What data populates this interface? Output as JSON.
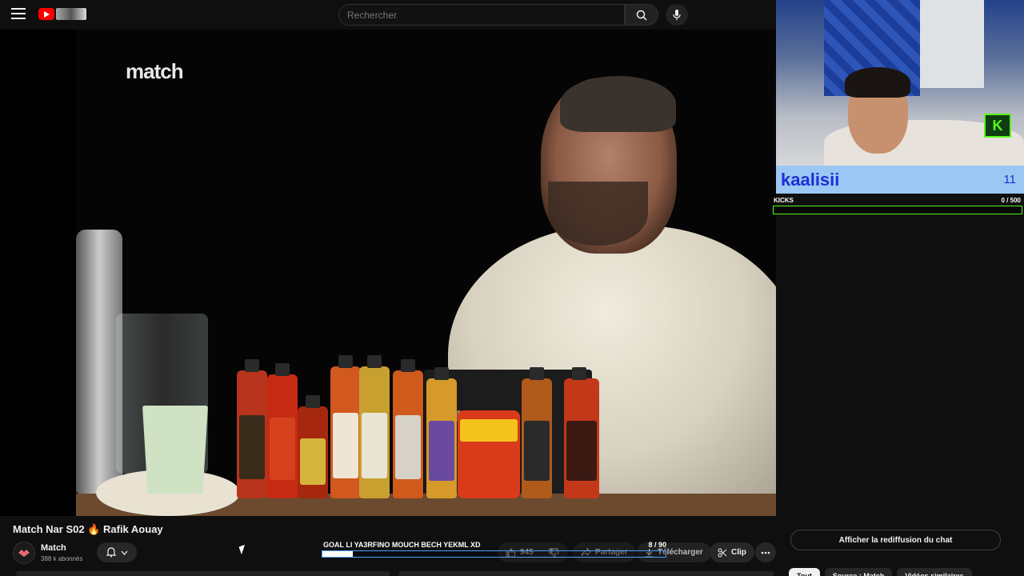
{
  "header": {
    "search_placeholder": "Rechercher"
  },
  "video": {
    "brand_text": "match"
  },
  "overlay": {
    "streamer_name": "kaalisii",
    "streamer_count": "11",
    "kicks_label": "KICKS",
    "kicks_value": "0 / 500",
    "kicks_progress": 0
  },
  "meta": {
    "title": "Match Nar S02 🔥 Rafik Aouay",
    "channel_name": "Match",
    "subscribers": "388 k abonnés"
  },
  "goal": {
    "label": "GOAL LI YA3RFINO MOUCH BECH YEKML XD",
    "value": "8  / 90",
    "progress": 0.089
  },
  "actions": {
    "likes": "945",
    "share": "Partager",
    "download": "Télécharger",
    "clip": "Clip"
  },
  "chat": {
    "replay_button": "Afficher la rediffusion du chat"
  },
  "chips": [
    "Tout",
    "Source : Match",
    "Vidéos similaires"
  ],
  "colors": {
    "kick_green": "#53fc18",
    "name_bar": "#9bc7f4",
    "name_text": "#1d2fd4",
    "yt_red": "#ff0000"
  }
}
